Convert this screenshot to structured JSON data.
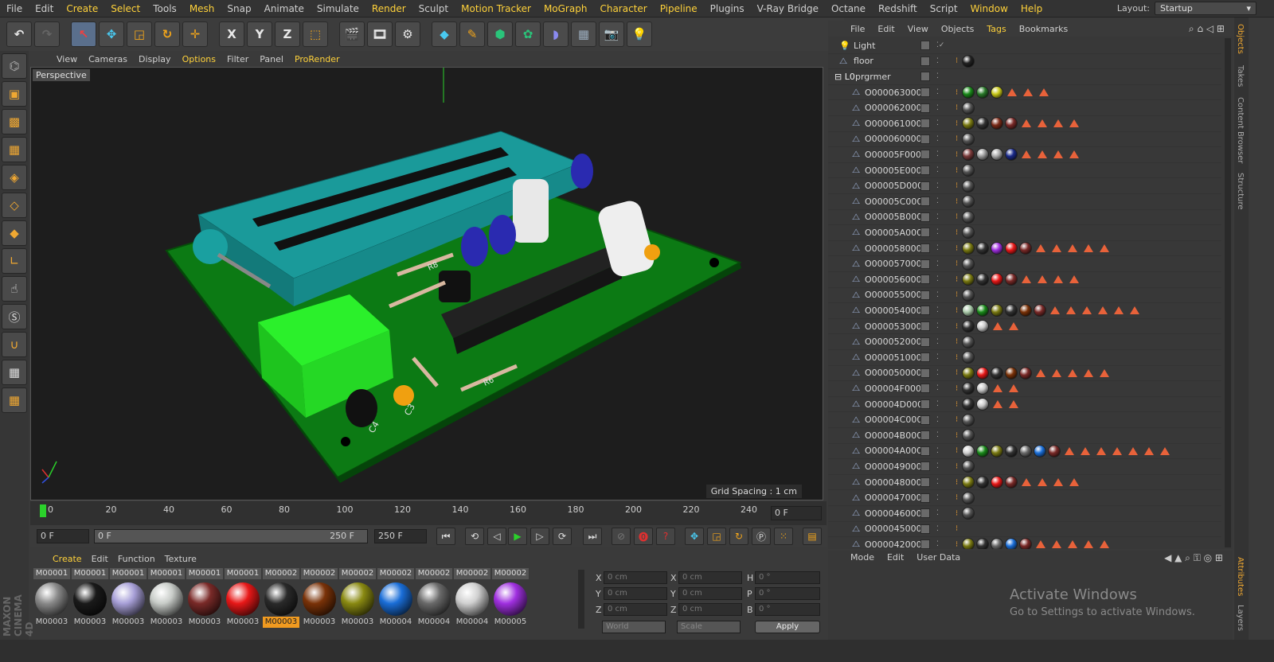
{
  "menu": {
    "items": [
      {
        "label": "File"
      },
      {
        "label": "Edit"
      },
      {
        "label": "Create",
        "hl": true
      },
      {
        "label": "Select",
        "hl": true
      },
      {
        "label": "Tools"
      },
      {
        "label": "Mesh",
        "hl": true
      },
      {
        "label": "Snap"
      },
      {
        "label": "Animate"
      },
      {
        "label": "Simulate"
      },
      {
        "label": "Render",
        "hl": true
      },
      {
        "label": "Sculpt"
      },
      {
        "label": "Motion Tracker",
        "hl": true
      },
      {
        "label": "MoGraph",
        "hl": true
      },
      {
        "label": "Character",
        "hl": true
      },
      {
        "label": "Pipeline",
        "hl": true
      },
      {
        "label": "Plugins"
      },
      {
        "label": "V-Ray Bridge"
      },
      {
        "label": "Octane"
      },
      {
        "label": "Redshift"
      },
      {
        "label": "Script"
      },
      {
        "label": "Window",
        "hl": true
      },
      {
        "label": "Help",
        "hl": true
      }
    ],
    "layout_label": "Layout:",
    "layout_value": "Startup"
  },
  "toolbar": {
    "axis_x": "X",
    "axis_y": "Y",
    "axis_z": "Z"
  },
  "viewport": {
    "menu": [
      {
        "label": "View"
      },
      {
        "label": "Cameras"
      },
      {
        "label": "Display"
      },
      {
        "label": "Options",
        "hl": true
      },
      {
        "label": "Filter"
      },
      {
        "label": "Panel"
      },
      {
        "label": "ProRender",
        "hl": true
      }
    ],
    "name": "Perspective",
    "grid_spacing": "Grid Spacing : 1 cm",
    "pcb_labels": {
      "c4": "C4",
      "c3": "C3",
      "r8": "R8",
      "r6": "R6"
    }
  },
  "timeline": {
    "ticks": [
      "0",
      "20",
      "40",
      "60",
      "80",
      "100",
      "120",
      "140",
      "160",
      "180",
      "200",
      "220",
      "240"
    ],
    "current_frame": "0 F",
    "start_frame": "0 F",
    "range_start": "0 F",
    "range_end": "250 F",
    "end_frame": "250 F"
  },
  "materials": {
    "menu": [
      {
        "label": "Create",
        "hl": true
      },
      {
        "label": "Edit"
      },
      {
        "label": "Function"
      },
      {
        "label": "Texture"
      }
    ],
    "items": [
      {
        "top": "M00001",
        "bottom": "M00003",
        "color": "#8a8a8a"
      },
      {
        "top": "M00001",
        "bottom": "M00003",
        "color": "#1a1a1a"
      },
      {
        "top": "M00001",
        "bottom": "M00003",
        "color": "#a8a0d8"
      },
      {
        "top": "M00001",
        "bottom": "M00003",
        "color": "#c8ccc8"
      },
      {
        "top": "M00001",
        "bottom": "M00003",
        "color": "#7a2a28"
      },
      {
        "top": "M00001",
        "bottom": "M00003",
        "color": "#e81818"
      },
      {
        "top": "M00002",
        "bottom": "M00003",
        "color": "#2a2a2a",
        "selected": true
      },
      {
        "top": "M00002",
        "bottom": "M00003",
        "color": "#7a3208"
      },
      {
        "top": "M00002",
        "bottom": "M00003",
        "color": "#8a8a12"
      },
      {
        "top": "M00002",
        "bottom": "M00004",
        "color": "#1a6ed8"
      },
      {
        "top": "M00002",
        "bottom": "M00004",
        "color": "#6a6a6a"
      },
      {
        "top": "M00002",
        "bottom": "M00004",
        "color": "#d0d0d0"
      },
      {
        "top": "M00002",
        "bottom": "M00005",
        "color": "#a030e0"
      }
    ]
  },
  "coordinates": {
    "pos_x": "0 cm",
    "pos_y": "0 cm",
    "pos_z": "0 cm",
    "size_x": "0 cm",
    "size_y": "0 cm",
    "size_z": "0 cm",
    "rot_h": "0 °",
    "rot_p": "0 °",
    "rot_b": "0 °",
    "mode1": "World",
    "mode2": "Scale",
    "apply": "Apply",
    "lx": "X",
    "ly": "Y",
    "lz": "Z",
    "sx": "X",
    "sy": "Y",
    "sz": "Z",
    "rh": "H",
    "rp": "P",
    "rb": "B"
  },
  "objects": {
    "menu": [
      {
        "label": "File"
      },
      {
        "label": "Edit"
      },
      {
        "label": "View"
      },
      {
        "label": "Objects"
      },
      {
        "label": "Tags",
        "hl": true
      },
      {
        "label": "Bookmarks"
      }
    ],
    "rows": [
      {
        "name": "Light",
        "indent": 1,
        "tags": []
      },
      {
        "name": "floor",
        "indent": 1,
        "tags": [
          "#222"
        ]
      },
      {
        "name": "prgrmer",
        "indent": 0,
        "tags": []
      },
      {
        "name": "O000063000",
        "indent": 2,
        "tags": [
          "#1a8a1a",
          "#2a7a2a",
          "#c8c818"
        ],
        "tri": 3
      },
      {
        "name": "O000062000",
        "indent": 2,
        "tags": [
          "#555"
        ],
        "tri": 0
      },
      {
        "name": "O000061000",
        "indent": 2,
        "tags": [
          "#7a7a12",
          "#333",
          "#7a2a18",
          "#7a2a28"
        ],
        "tri": 4
      },
      {
        "name": "O000060000",
        "indent": 2,
        "tags": [
          "#555"
        ],
        "tri": 0
      },
      {
        "name": "O00005F000",
        "indent": 2,
        "tags": [
          "#7a3a3a",
          "#9a9a9a",
          "#aaa",
          "#1a2a8a"
        ],
        "tri": 4
      },
      {
        "name": "O00005E000",
        "indent": 2,
        "tags": [
          "#555"
        ],
        "tri": 0
      },
      {
        "name": "O00005D000",
        "indent": 2,
        "tags": [
          "#555"
        ],
        "tri": 0
      },
      {
        "name": "O00005C000",
        "indent": 2,
        "tags": [
          "#555"
        ],
        "tri": 0
      },
      {
        "name": "O00005B000",
        "indent": 2,
        "tags": [
          "#555"
        ],
        "tri": 0
      },
      {
        "name": "O00005A000",
        "indent": 2,
        "tags": [
          "#555"
        ],
        "tri": 0
      },
      {
        "name": "O000058000",
        "indent": 2,
        "tags": [
          "#7a7a12",
          "#333",
          "#a030e0",
          "#e81818",
          "#7a2a28"
        ],
        "tri": 5
      },
      {
        "name": "O000057000",
        "indent": 2,
        "tags": [
          "#555"
        ],
        "tri": 0
      },
      {
        "name": "O000056000",
        "indent": 2,
        "tags": [
          "#7a7a12",
          "#333",
          "#e81818",
          "#7a2a28"
        ],
        "tri": 4
      },
      {
        "name": "O000055000",
        "indent": 2,
        "tags": [
          "#555"
        ],
        "tri": 0
      },
      {
        "name": "O000054000",
        "indent": 2,
        "tags": [
          "#a8c8a8",
          "#1a8a1a",
          "#7a7a12",
          "#333",
          "#7a3208",
          "#7a2a28"
        ],
        "tri": 6
      },
      {
        "name": "O000053000",
        "indent": 2,
        "tags": [
          "#333",
          "#c8c8c8"
        ],
        "tri": 2
      },
      {
        "name": "O000052000",
        "indent": 2,
        "tags": [
          "#555"
        ],
        "tri": 0
      },
      {
        "name": "O000051000",
        "indent": 2,
        "tags": [
          "#555"
        ],
        "tri": 0
      },
      {
        "name": "O000050000",
        "indent": 2,
        "tags": [
          "#7a7a12",
          "#e81818",
          "#333",
          "#7a3208",
          "#7a2a28"
        ],
        "tri": 5
      },
      {
        "name": "O00004F000",
        "indent": 2,
        "tags": [
          "#333",
          "#c8c8c8"
        ],
        "tri": 2
      },
      {
        "name": "O00004D000",
        "indent": 2,
        "tags": [
          "#333",
          "#c8c8c8"
        ],
        "tri": 2
      },
      {
        "name": "O00004C000",
        "indent": 2,
        "tags": [
          "#555"
        ],
        "tri": 0
      },
      {
        "name": "O00004B000",
        "indent": 2,
        "tags": [
          "#555"
        ],
        "tri": 0
      },
      {
        "name": "O00004A000",
        "indent": 2,
        "tags": [
          "#d0d0d0",
          "#1a8a1a",
          "#7a7a12",
          "#333",
          "#6a6a6a",
          "#1a6ed8",
          "#7a2a28"
        ],
        "tri": 7
      },
      {
        "name": "O000049000",
        "indent": 2,
        "tags": [
          "#555"
        ],
        "tri": 0
      },
      {
        "name": "O000048000",
        "indent": 2,
        "tags": [
          "#7a7a12",
          "#333",
          "#e81818",
          "#7a2a28"
        ],
        "tri": 4
      },
      {
        "name": "O000047000",
        "indent": 2,
        "tags": [
          "#555"
        ],
        "tri": 0
      },
      {
        "name": "O000046000",
        "indent": 2,
        "tags": [
          "#555"
        ],
        "tri": 0
      },
      {
        "name": "O000045000",
        "indent": 2,
        "tags": [],
        "tri": 0
      },
      {
        "name": "O000042000",
        "indent": 2,
        "tags": [
          "#7a7a12",
          "#333",
          "#6a6a6a",
          "#1a6ed8",
          "#7a2a28"
        ],
        "tri": 5
      }
    ]
  },
  "attributes": {
    "menu": [
      {
        "label": "Mode"
      },
      {
        "label": "Edit"
      },
      {
        "label": "User Data"
      }
    ],
    "watermark_title": "Activate Windows",
    "watermark_sub": "Go to Settings to activate Windows."
  },
  "sidebar_tabs": [
    "Objects",
    "Takes",
    "Content Browser",
    "Structure",
    "Attributes",
    "Layers"
  ],
  "brand": {
    "maxon": "MAXON",
    "product": "CINEMA 4D"
  }
}
